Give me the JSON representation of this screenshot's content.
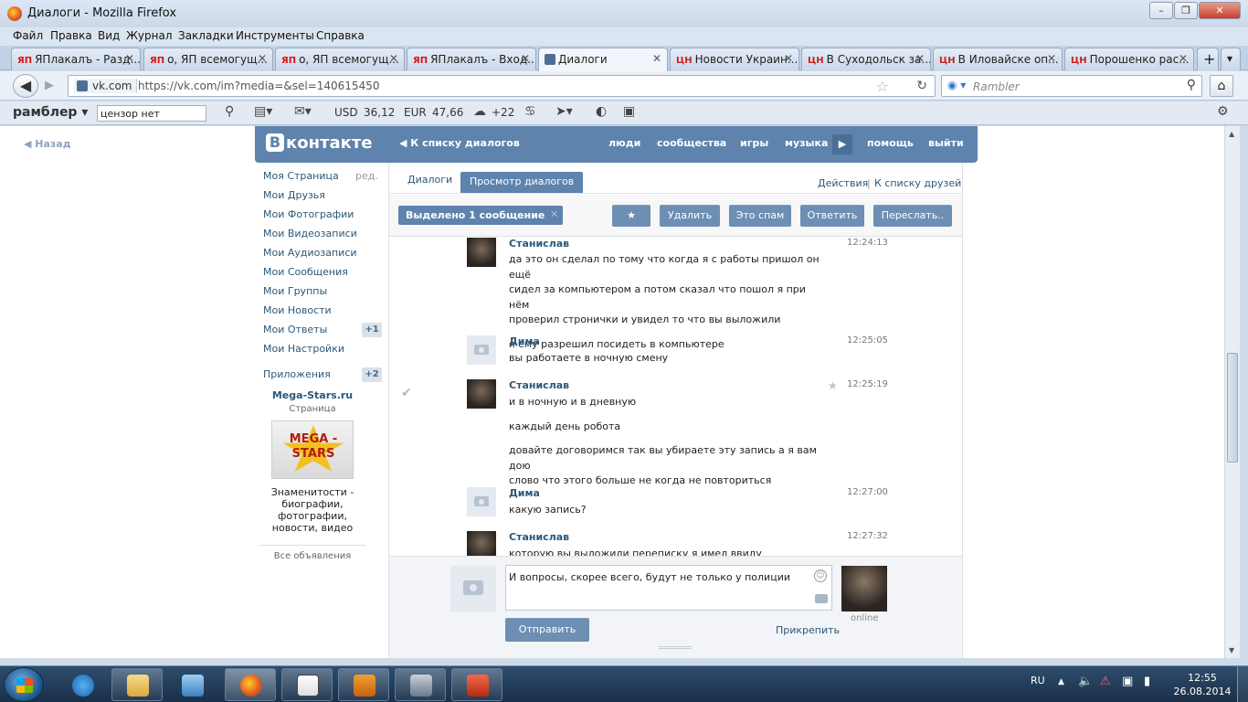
{
  "window": {
    "title": "Диалоги - Mozilla Firefox",
    "minimize": "–",
    "maximize": "❐",
    "close": "✕"
  },
  "menu": [
    "Файл",
    "Правка",
    "Вид",
    "Журнал",
    "Закладки",
    "Инструменты",
    "Справка"
  ],
  "tabs": [
    {
      "fav": "ЯП",
      "label": "ЯПлакалъ - Разд..."
    },
    {
      "fav": "ЯП",
      "label": "о, ЯП всемогущ..."
    },
    {
      "fav": "ЯП",
      "label": "о, ЯП всемогущ..."
    },
    {
      "fav": "ЯП",
      "label": "ЯПлакалъ - Вход..."
    },
    {
      "fav": "",
      "label": "Диалоги"
    },
    {
      "fav": "ЦН",
      "label": "Новости Украин..."
    },
    {
      "fav": "ЦН",
      "label": "В Суходольск за..."
    },
    {
      "fav": "ЦН",
      "label": "В Иловайске оп..."
    },
    {
      "fav": "ЦН",
      "label": "Порошенко рас..."
    }
  ],
  "tab_close": "✕",
  "tab_new": "+",
  "tab_list": "▾",
  "nav": {
    "back": "◀",
    "forward": "▶",
    "site": "vk.com",
    "url": "https://vk.com/im?media=&sel=140615450",
    "star": "☆",
    "reload": "↻",
    "engine": "◉ ▾",
    "search_placeholder": "Rambler",
    "search": "⚲",
    "home": "⌂"
  },
  "rambler": {
    "logo": "рамблер ▾",
    "query": "цензор нет",
    "usd_label": "USD",
    "usd": "36,12",
    "eur_label": "EUR",
    "eur": "47,66",
    "temp": "+22"
  },
  "vk": {
    "back_link": "◀  Назад",
    "logo_letter": "В",
    "logo_text": "контакте",
    "to_list": "◀  К списку диалогов",
    "top_links": [
      "люди",
      "сообщества",
      "игры",
      "музыка",
      "помощь",
      "выйти"
    ],
    "play": "▶",
    "left_menu": [
      "Моя Страница",
      "Мои Друзья",
      "Мои Фотографии",
      "Мои Видеозаписи",
      "Мои Аудиозаписи",
      "Мои Сообщения",
      "Мои Группы",
      "Мои Новости",
      "Мои Ответы",
      "Мои Настройки",
      "Приложения"
    ],
    "edit": "ред.",
    "answers_badge": "+1",
    "apps_badge": "+2",
    "ad": {
      "title": "Mega-Stars.ru",
      "sub": "Страница",
      "img_text": "MEGA - STARS",
      "desc": "Знаменитости - биографии, фотографии, новости, видео",
      "all": "Все объявления"
    },
    "tabs": [
      "Диалоги",
      "Просмотр диалогов"
    ],
    "actions": "Действия",
    "sep": "|",
    "friends": "К списку друзей",
    "selected": "Выделено 1 сообщение",
    "sel_close": "✕",
    "star_btn": "★",
    "buttons": [
      "Удалить",
      "Это спам",
      "Ответить",
      "Переслать.."
    ],
    "messages": [
      {
        "author": "Станислав",
        "time": "12:24:13",
        "lines": [
          "да это он сделал по тому что когда я с работы пришол он ещё",
          "сидел за компьютером а потом сказал что пошол я при нём",
          "проверил стронички и увидел то что вы выложили",
          "",
          "я ему разрешил посидеть в компьютере"
        ]
      },
      {
        "author": "Дима",
        "time": "12:25:05",
        "lines": [
          "вы работаете в ночную смену"
        ]
      },
      {
        "author": "Станислав",
        "time": "12:25:19",
        "lines": [
          "и в ночную и в дневную",
          "",
          "каждый день робота",
          "",
          "довайте договоримся так вы убираете эту запись а я вам дою",
          "слово что этого больше не когда не повториться"
        ]
      },
      {
        "author": "Дима",
        "time": "12:27:00",
        "lines": [
          "какую запись?"
        ]
      },
      {
        "author": "Станислав",
        "time": "12:27:32",
        "lines": [
          "которую вы выложили переписку я имел ввиду"
        ]
      }
    ],
    "check": "✔",
    "msg_star": "★",
    "compose_text": "И вопросы, скорее всего, будут не только у полиции",
    "smile": "☺",
    "send": "Отправить",
    "attach": "Прикрепить",
    "online": "online"
  },
  "taskbar": {
    "lang": "RU",
    "tray_arrow": "▲",
    "time": "12:55",
    "date": "26.08.2014"
  }
}
